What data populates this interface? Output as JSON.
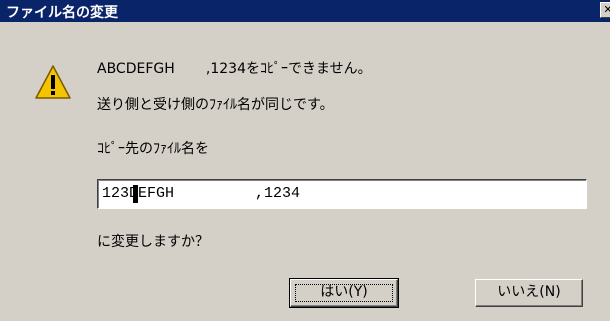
{
  "window": {
    "title": "ファイル名の変更",
    "close_label": "✕"
  },
  "icon": "warning-icon",
  "message": {
    "line1": "ABCDEFGH       ,1234をｺﾋﾟｰできません。",
    "line2": "送り側と受け側のﾌｧｲﾙ名が同じです。",
    "prompt": "ｺﾋﾟｰ先のﾌｧｲﾙ名を",
    "question": "に変更しますか？"
  },
  "filename_input": {
    "value": "123DEFGH         ,1234"
  },
  "buttons": {
    "yes": "はい(Y)",
    "no": "いいえ(N)"
  }
}
